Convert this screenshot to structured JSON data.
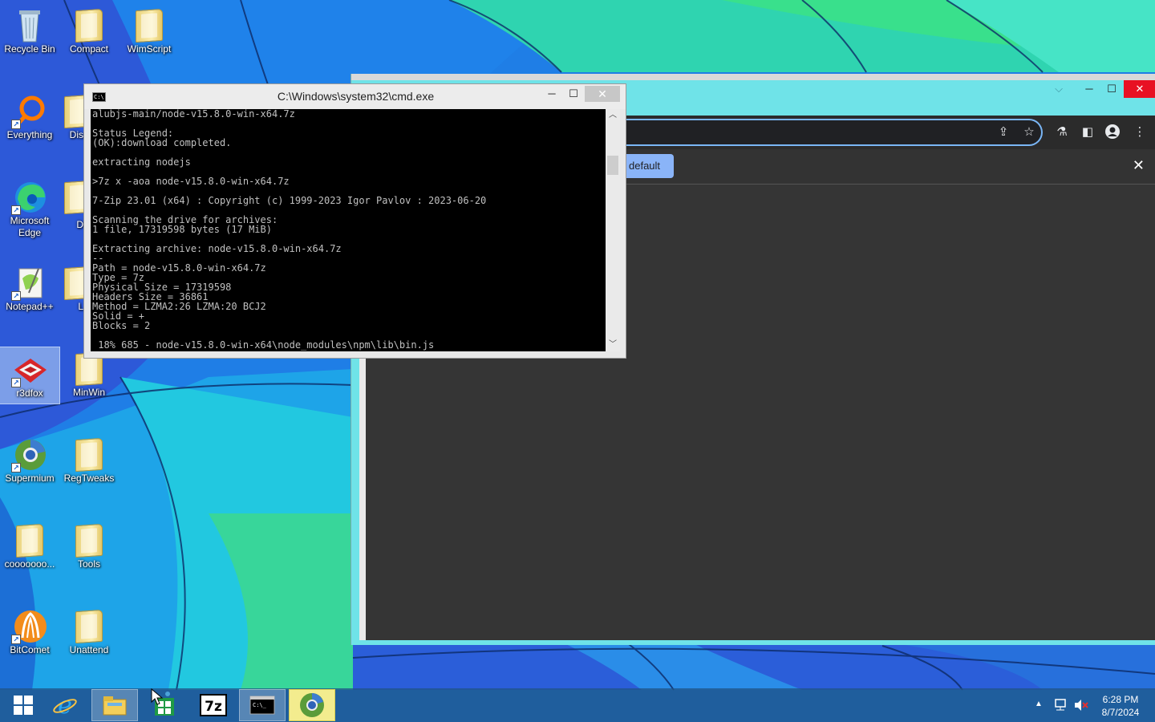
{
  "desktop": {
    "icons": [
      {
        "label": "Recycle Bin"
      },
      {
        "label": "Compact"
      },
      {
        "label": "WimScript"
      },
      {
        "label": "Everything"
      },
      {
        "label": "Dis"
      },
      {
        "label": "Microsoft Edge"
      },
      {
        "label": "D"
      },
      {
        "label": "Notepad++"
      },
      {
        "label": "L"
      },
      {
        "label": "r3dfox"
      },
      {
        "label": "MinWin"
      },
      {
        "label": "Supermium"
      },
      {
        "label": "RegTweaks"
      },
      {
        "label": "cooooooo..."
      },
      {
        "label": "Tools"
      },
      {
        "label": "BitComet"
      },
      {
        "label": "Unattend"
      }
    ]
  },
  "browser": {
    "infobar_button": "default",
    "infobar_close": "✕",
    "colors": {
      "frame": "#6fe3e8",
      "content": "#353535",
      "accent": "#8ab4f8"
    }
  },
  "cmd": {
    "title": "C:\\Windows\\system32\\cmd.exe",
    "lines": [
      "alubjs-main/node-v15.8.0-win-x64.7z",
      "",
      "Status Legend:",
      "(OK):download completed.",
      "",
      "extracting nodejs",
      "",
      ">7z x -aoa node-v15.8.0-win-x64.7z",
      "",
      "7-Zip 23.01 (x64) : Copyright (c) 1999-2023 Igor Pavlov : 2023-06-20",
      "",
      "Scanning the drive for archives:",
      "1 file, 17319598 bytes (17 MiB)",
      "",
      "Extracting archive: node-v15.8.0-win-x64.7z",
      "--",
      "Path = node-v15.8.0-win-x64.7z",
      "Type = 7z",
      "Physical Size = 17319598",
      "Headers Size = 36861",
      "Method = LZMA2:26 LZMA:20 BCJ2",
      "Solid = +",
      "Blocks = 2",
      "",
      " 18% 685 - node-v15.8.0-win-x64\\node_modules\\npm\\lib\\bin.js"
    ]
  },
  "taskbar": {
    "items": [
      "start",
      "internet-explorer",
      "file-explorer",
      "store",
      "7-zip",
      "command-prompt",
      "supermium"
    ],
    "time": "6:28 PM",
    "date": "8/7/2024"
  }
}
